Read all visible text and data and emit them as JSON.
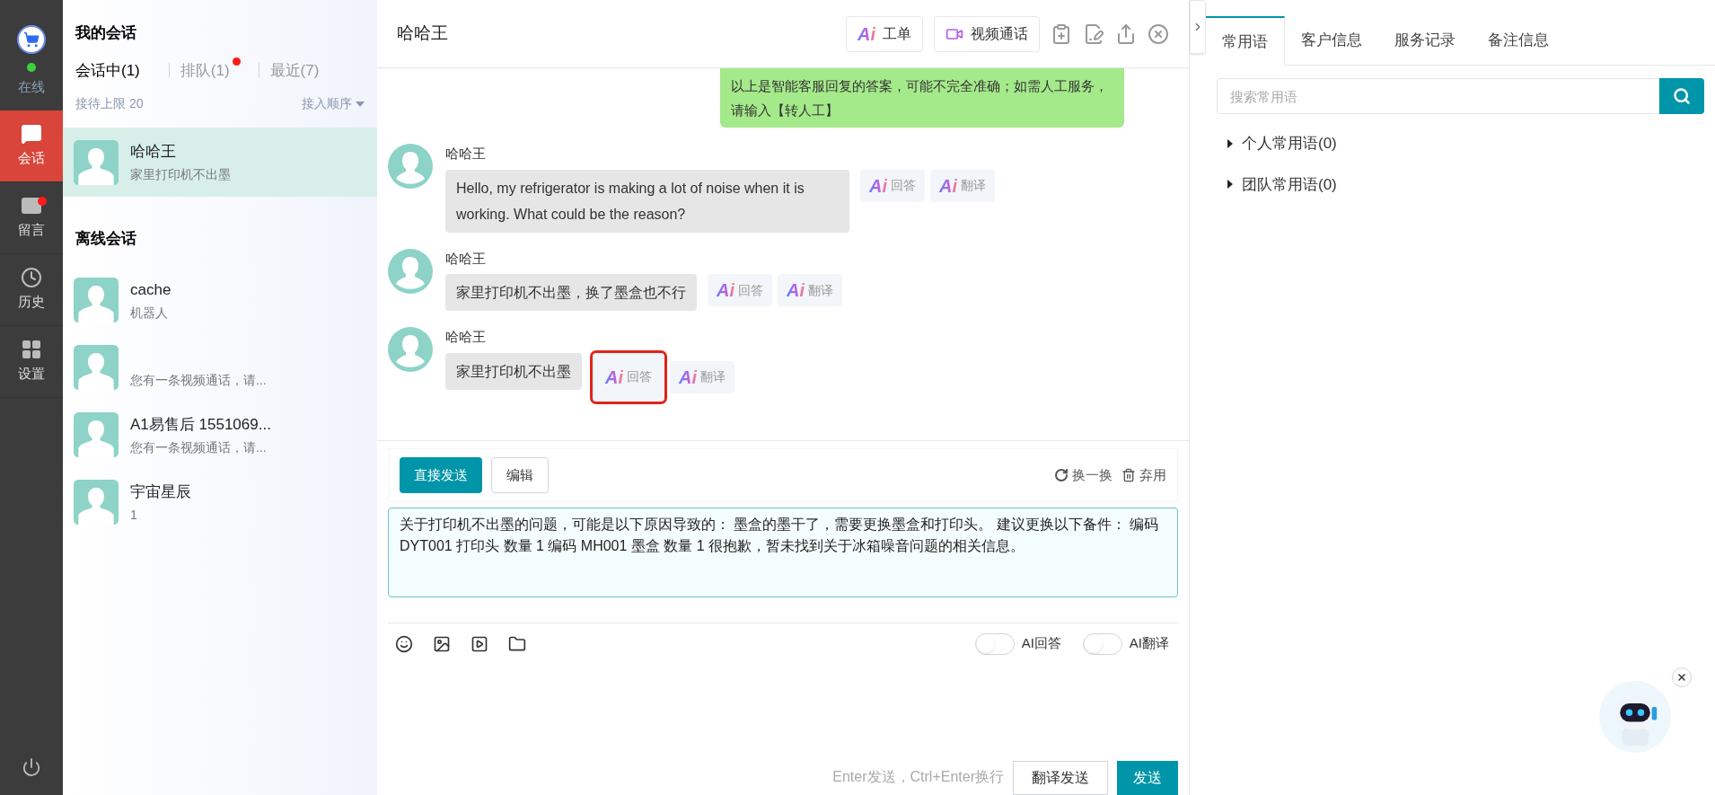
{
  "nav": {
    "status": "在线",
    "online": true,
    "items": [
      {
        "label": "会话",
        "kind": "chat",
        "selected": true,
        "badge": false
      },
      {
        "label": "留言",
        "kind": "mail",
        "selected": false,
        "badge": true
      },
      {
        "label": "历史",
        "kind": "clock",
        "selected": false,
        "badge": false
      },
      {
        "label": "设置",
        "kind": "grid",
        "selected": false,
        "badge": false
      }
    ]
  },
  "sessions": {
    "title": "我的会话",
    "tabs": [
      {
        "label": "会话中(1)",
        "selected": true,
        "badge": false
      },
      {
        "label": "排队(1)",
        "selected": false,
        "badge": true
      },
      {
        "label": "最近(7)",
        "selected": false,
        "badge": false
      }
    ],
    "limit": "接待上限 20",
    "sort": "接入顺序",
    "active": [
      {
        "name": "哈哈王",
        "preview": "家里打印机不出墨",
        "selected": true
      }
    ],
    "offline_title": "离线会话",
    "offline": [
      {
        "name": "cache",
        "preview": "机器人",
        "selected": false
      },
      {
        "preview": "您有一条视频通话，请...",
        "selected": false
      },
      {
        "name": "A1易售后 1551069...",
        "preview": "您有一条视频通话，请...",
        "selected": false
      },
      {
        "name": "宇宙星辰",
        "preview": "1",
        "selected": false
      }
    ]
  },
  "chat": {
    "title": "哈哈王",
    "header_buttons": [
      {
        "kind": "ai",
        "logo": "Ai",
        "label": "工单"
      },
      {
        "kind": "video",
        "label": "视频通话"
      }
    ],
    "messages": [
      {
        "kind": "agent",
        "text": "以上是智能客服回复的答案，可能不完全准确；如需人工服务，请输入【转人工】"
      },
      {
        "kind": "customer",
        "sender": "哈哈王",
        "text": "Hello, my refrigerator is making a lot of noise when it is working. What could be the reason?",
        "actions": [
          {
            "logo": "Ai",
            "label": "回答",
            "highlighted": false
          },
          {
            "logo": "Ai",
            "label": "翻译",
            "highlighted": false
          }
        ]
      },
      {
        "kind": "customer",
        "sender": "哈哈王",
        "text": "家里打印机不出墨，换了墨盒也不行",
        "actions": [
          {
            "logo": "Ai",
            "label": "回答",
            "highlighted": false
          },
          {
            "logo": "Ai",
            "label": "翻译",
            "highlighted": false
          }
        ]
      },
      {
        "kind": "customer",
        "sender": "哈哈王",
        "text": "家里打印机不出墨",
        "actions": [
          {
            "logo": "Ai",
            "label": "回答",
            "highlighted": true
          },
          {
            "logo": "Ai",
            "label": "翻译",
            "highlighted": false
          }
        ]
      }
    ],
    "suggestion": {
      "send": "直接发送",
      "edit": "编辑",
      "refresh": "换一换",
      "discard": "弃用",
      "text": "关于打印机不出墨的问题，可能是以下原因导致的： 墨盒的墨干了，需要更换墨盒和打印头。 建议更换以下备件： 编码 DYT001 打印头 数量 1 编码 MH001 墨盒 数量 1 很抱歉，暂未找到关于冰箱噪音问题的相关信息。"
    },
    "toggles": [
      {
        "label": "AI回答",
        "on": false
      },
      {
        "label": "AI翻译",
        "on": false
      }
    ],
    "hint": "Enter发送，Ctrl+Enter换行",
    "translate_send": "翻译发送",
    "send": "发送"
  },
  "side": {
    "tabs": [
      {
        "label": "常用语",
        "selected": true
      },
      {
        "label": "客户信息",
        "selected": false
      },
      {
        "label": "服务记录",
        "selected": false
      },
      {
        "label": "备注信息",
        "selected": false
      }
    ],
    "search_placeholder": "搜索常用语",
    "groups": [
      {
        "label": "个人常用语(0)",
        "expanded": false
      },
      {
        "label": "团队常用语(0)",
        "expanded": false
      }
    ]
  }
}
